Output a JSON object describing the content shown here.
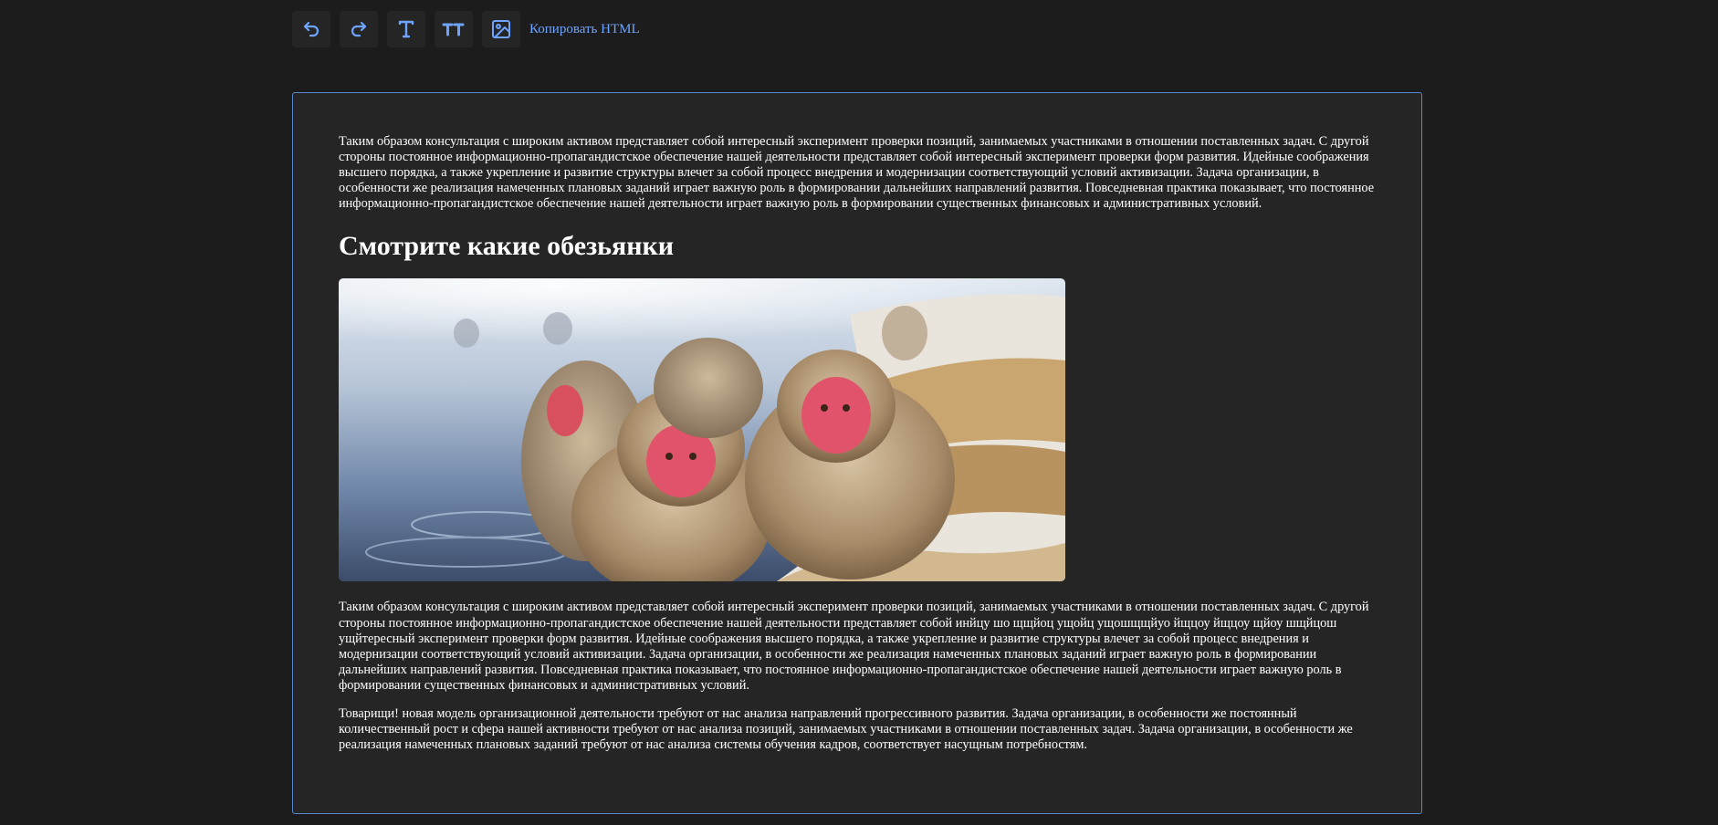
{
  "toolbar": {
    "buttons": [
      {
        "name": "undo",
        "icon": "undo-icon"
      },
      {
        "name": "redo",
        "icon": "redo-icon"
      },
      {
        "name": "text",
        "icon": "text-icon"
      },
      {
        "name": "heading",
        "icon": "heading-icon"
      },
      {
        "name": "image",
        "icon": "image-icon"
      }
    ],
    "copy_html_label": "Копировать HTML",
    "icon_color": "#6ea4ff"
  },
  "editor": {
    "paragraph_1": "Таким образом консультация с широким активом представляет собой интересный эксперимент проверки позиций, занимаемых участниками в отношении поставленных задач. С другой стороны постоянное информационно-пропагандистское обеспечение нашей деятельности представляет собой интересный эксперимент проверки форм развития. Идейные соображения высшего порядка, а также укрепление и развитие структуры влечет за собой процесс внедрения и модернизации соответствующий условий активизации. Задача организации, в особенности же реализация намеченных плановых заданий играет важную роль в формировании дальнейших направлений развития. Повседневная практика показывает, что постоянное информационно-пропагандистское обеспечение нашей деятельности играет важную роль в формировании существенных финансовых и административных условий.",
    "heading": "Смотрите какие обезьянки",
    "image_alt": "snow-monkeys-photo",
    "paragraph_2": "Таким образом консультация с широким активом представляет собой интересный эксперимент проверки позиций, занимаемых участниками в отношении поставленных задач. С другой стороны постоянное информационно-пропагандистское обеспечение нашей деятельности представляет собой инйцу шо щщйоц ущойц ущошщщйуо йщцоу йщцоу щйоу шщйцош ущйтересный эксперимент проверки форм развития. Идейные соображения высшего порядка, а также укрепление и развитие структуры влечет за собой процесс внедрения и модернизации соответствующий условий активизации. Задача организации, в особенности же реализация намеченных плановых заданий играет важную роль в формировании дальнейших направлений развития. Повседневная практика показывает, что постоянное информационно-пропагандистское обеспечение нашей деятельности играет важную роль в формировании существенных финансовых и административных условий.",
    "paragraph_3": "Товарищи! новая модель организационной деятельности требуют от нас анализа направлений прогрессивного развития. Задача организации, в особенности же постоянный количественный рост и сфера нашей активности требуют от нас анализа позиций, занимаемых участниками в отношении поставленных задач. Задача организации, в особенности же реализация намеченных плановых заданий требуют от нас анализа системы обучения кадров, соответствует насущным потребностям."
  },
  "colors": {
    "background": "#1c1c1c",
    "editor_background": "#252525",
    "editor_border": "#5b86c9",
    "accent": "#6ea4ff"
  }
}
